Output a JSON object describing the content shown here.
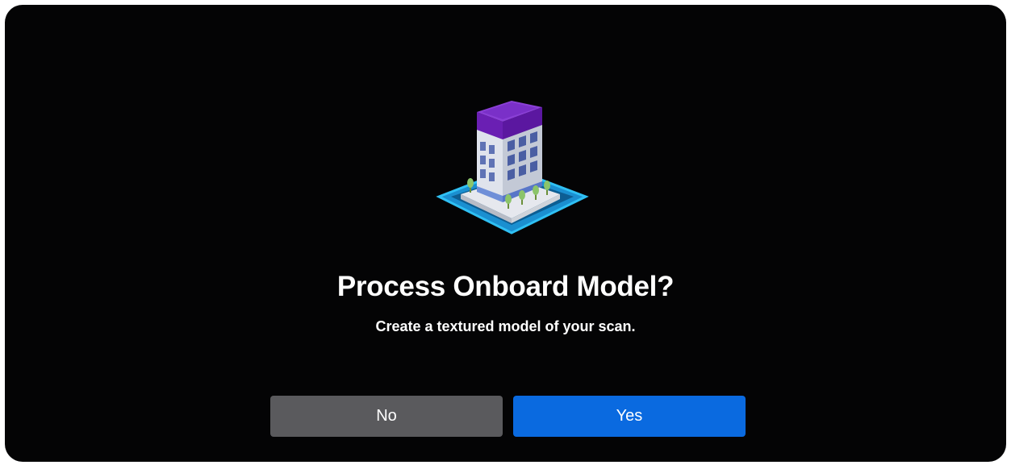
{
  "dialog": {
    "icon": "building-model-icon",
    "title": "Process Onboard Model?",
    "subtitle": "Create a textured model of your scan.",
    "no_label": "No",
    "yes_label": "Yes"
  },
  "colors": {
    "background": "#040405",
    "no_button": "#5a5a5d",
    "yes_button": "#0a6ae0",
    "roof": "#7b2fc4",
    "base_outline": "#1aa7e6"
  }
}
